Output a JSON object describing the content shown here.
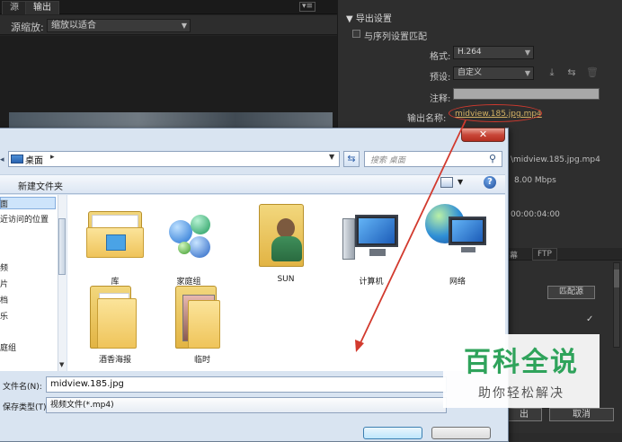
{
  "left_panel": {
    "tabs": [
      "源",
      "输出"
    ],
    "menu_glyph": "▾≡",
    "scale_label": "源缩放:",
    "scale_value": "缩放以适合"
  },
  "right_panel": {
    "section_title": "导出设置",
    "match_sequence_label": "与序列设置匹配",
    "format_label": "格式:",
    "format_value": "H.264",
    "preset_label": "预设:",
    "preset_value": "自定义",
    "note_label": "注释:",
    "output_name_label": "输出名称:",
    "output_name_value": "midview.185.jpg.mp4",
    "summary_path": "\\midview.185.jpg.mp4",
    "summary_bitrate": "8.00 Mbps",
    "summary_time": "00:00:04:00",
    "tab_partial": "幕",
    "tab_ftp": "FTP",
    "match_source_button": "匹配源",
    "ok_partial": "出",
    "cancel_button": "取消"
  },
  "dialog": {
    "close_glyph": "✕",
    "address": "桌面",
    "address_sep": "▸",
    "search_placeholder": "搜索 桌面",
    "new_folder": "新建文件夹",
    "nav": {
      "desktop": "桌面",
      "recent": "最近访问的位置",
      "video": "视频",
      "pictures": "图片",
      "documents": "文档",
      "music": "音乐",
      "homegroup": "家庭组"
    },
    "items": [
      {
        "label": "库",
        "icon": "library-folder-icon"
      },
      {
        "label": "家庭组",
        "icon": "homegroup-icon"
      },
      {
        "label": "SUN",
        "icon": "user-folder-icon"
      },
      {
        "label": "计算机",
        "icon": "computer-icon"
      },
      {
        "label": "网络",
        "icon": "network-icon"
      },
      {
        "label": "酒香海报",
        "icon": "folder-icon"
      },
      {
        "label": "临时",
        "icon": "folder-icon"
      }
    ],
    "filename_label": "文件名(N):",
    "filename_value": "midview.185.jpg",
    "filetype_label": "保存类型(T):",
    "filetype_value": "视频文件(*.mp4)"
  },
  "watermark": {
    "title": "百科全说",
    "subtitle": "助你轻松解决"
  },
  "colors": {
    "annotation_red": "#d23a2e",
    "watermark_green": "#2fa35b",
    "link_gold": "#d4b264"
  }
}
